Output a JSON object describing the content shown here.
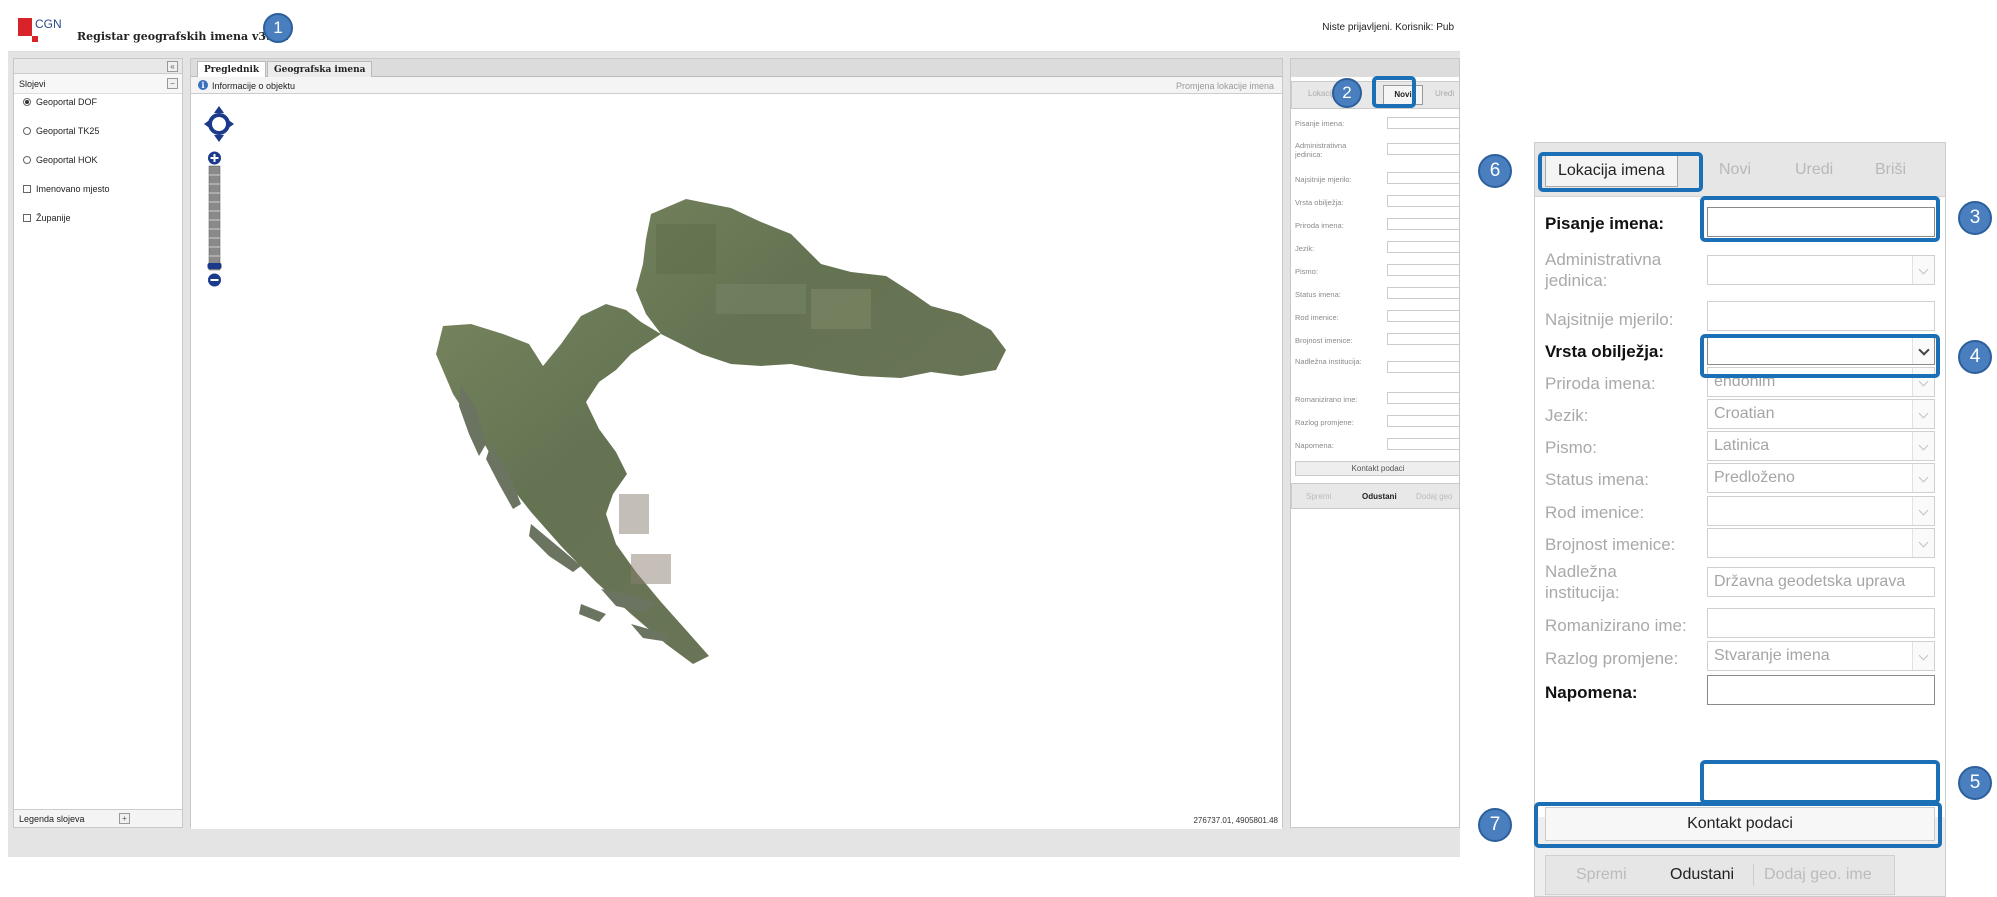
{
  "header": {
    "logo_text": "CGN",
    "app_title": "Registar geografskih imena v3.2.1",
    "login_status": "Niste prijavljeni. Korisnik: Pub"
  },
  "left_panel": {
    "collapse_symbol": "«",
    "title": "Slojevi",
    "minimize_symbol": "−",
    "layers": [
      {
        "label": "Geoportal DOF",
        "type": "radio",
        "checked": true
      },
      {
        "label": "Geoportal TK25",
        "type": "radio",
        "checked": false
      },
      {
        "label": "Geoportal HOK",
        "type": "radio",
        "checked": false
      },
      {
        "label": "Imenovano mjesto",
        "type": "checkbox",
        "checked": false
      },
      {
        "label": "Županije",
        "type": "checkbox",
        "checked": false
      }
    ],
    "legend_label": "Legenda slojeva",
    "legend_expand": "+"
  },
  "center": {
    "tabs": [
      {
        "label": "Preglednik",
        "active": true
      },
      {
        "label": "Geografska imena",
        "active": false
      }
    ],
    "info_icon_glyph": "i",
    "info_label": "Informacije o objektu",
    "move_label": "Promjena lokacije imena",
    "coordinates": "276737.01, 4905801.48",
    "zoom_in": "+",
    "zoom_out": "−"
  },
  "right_panel_small": {
    "tabs": [
      "Lokacija imena",
      "Novi",
      "Uredi"
    ],
    "novi_label": "Novi",
    "fields": [
      "Pisanje imena:",
      "Administrativna jedinica:",
      "Najsitnije mjerilo:",
      "Vrsta obilježja:",
      "Priroda imena:",
      "Jezik:",
      "Pismo:",
      "Status imena:",
      "Rod imenice:",
      "Brojnost imenice:",
      "Nadležna institucija:",
      "Romanizirano ime:",
      "Razlog promjene:",
      "Napomena:"
    ],
    "kontakt_label": "Kontakt podaci",
    "buttons": [
      "Spremi",
      "Odustani",
      "Dodaj geo"
    ]
  },
  "zoom_panel": {
    "tabs": [
      {
        "label": "Lokacija imena",
        "active": true
      },
      {
        "label": "Novi",
        "active": false
      },
      {
        "label": "Uredi",
        "active": false
      },
      {
        "label": "Briši",
        "active": false
      }
    ],
    "fields": [
      {
        "label": "Pisanje imena:",
        "value": "",
        "required": true,
        "dropdown": false
      },
      {
        "label": "Administrativna jedinica:",
        "value": "",
        "required": false,
        "dropdown": true
      },
      {
        "label": "Najsitnije mjerilo:",
        "value": "",
        "required": false,
        "dropdown": false
      },
      {
        "label": "Vrsta obilježja:",
        "value": "",
        "required": true,
        "dropdown": true
      },
      {
        "label": "Priroda imena:",
        "value": "endonim",
        "required": false,
        "dropdown": true
      },
      {
        "label": "Jezik:",
        "value": "Croatian",
        "required": false,
        "dropdown": true
      },
      {
        "label": "Pismo:",
        "value": "Latinica",
        "required": false,
        "dropdown": true
      },
      {
        "label": "Status imena:",
        "value": "Predloženo",
        "required": false,
        "dropdown": true
      },
      {
        "label": "Rod imenice:",
        "value": "",
        "required": false,
        "dropdown": true
      },
      {
        "label": "Brojnost imenice:",
        "value": "",
        "required": false,
        "dropdown": true
      },
      {
        "label": "Nadležna institucija:",
        "value": "Državna geodetska uprava",
        "required": false,
        "dropdown": false
      },
      {
        "label": "Romanizirano ime:",
        "value": "",
        "required": false,
        "dropdown": false
      },
      {
        "label": "Razlog promjene:",
        "value": "Stvaranje imena",
        "required": false,
        "dropdown": true
      },
      {
        "label": "Napomena:",
        "value": "",
        "required": true,
        "dropdown": false
      }
    ],
    "kontakt_label": "Kontakt podaci",
    "buttons": [
      {
        "label": "Spremi",
        "enabled": false
      },
      {
        "label": "Odustani",
        "enabled": true
      },
      {
        "label": "Dodaj geo. ime",
        "enabled": false
      }
    ]
  },
  "callouts": [
    "1",
    "2",
    "3",
    "4",
    "5",
    "6",
    "7"
  ],
  "colors": {
    "callout_blue": "#1a6fb5",
    "logo_red": "#d9232b",
    "map_green": "#6e7f5a"
  }
}
